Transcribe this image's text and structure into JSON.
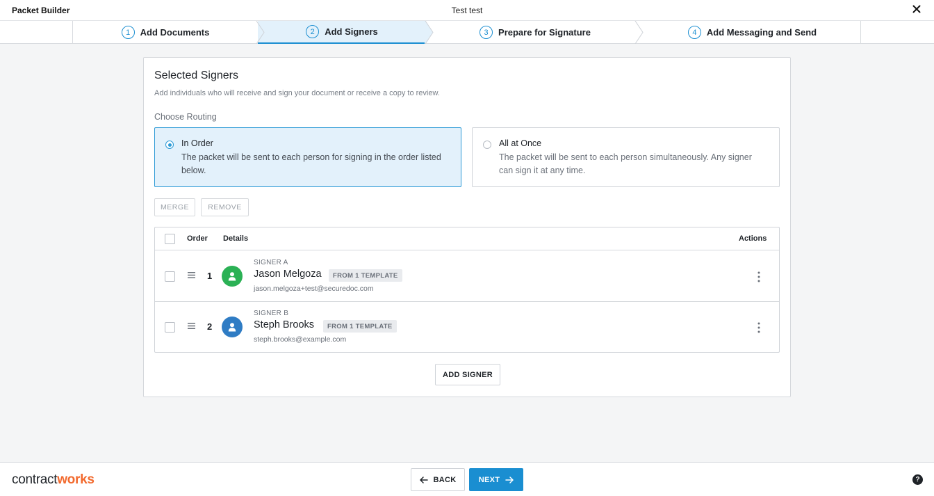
{
  "header": {
    "app_title": "Packet Builder",
    "doc_title": "Test test",
    "close_icon": "close-icon"
  },
  "stepper": {
    "steps": [
      {
        "num": "1",
        "label": "Add Documents",
        "active": false
      },
      {
        "num": "2",
        "label": "Add Signers",
        "active": true
      },
      {
        "num": "3",
        "label": "Prepare for Signature",
        "active": false
      },
      {
        "num": "4",
        "label": "Add Messaging and Send",
        "active": false
      }
    ]
  },
  "card": {
    "title": "Selected Signers",
    "subtitle": "Add individuals who will receive and sign your document or receive a copy to review.",
    "routing_label": "Choose Routing",
    "routing": [
      {
        "title": "In Order",
        "desc": "The packet will be sent to each person for signing in the order listed below.",
        "selected": true
      },
      {
        "title": "All at Once",
        "desc": "The packet will be sent to each person simultaneously. Any signer can sign it at any time.",
        "selected": false
      }
    ],
    "merge_label": "MERGE",
    "remove_label": "REMOVE",
    "table": {
      "headers": {
        "order": "Order",
        "details": "Details",
        "actions": "Actions"
      },
      "rows": [
        {
          "order": "1",
          "role": "SIGNER A",
          "name": "Jason Melgoza",
          "badge": "FROM 1 TEMPLATE",
          "email": "jason.melgoza+test@securedoc.com",
          "avatar_color": "#2bb155"
        },
        {
          "order": "2",
          "role": "SIGNER B",
          "name": "Steph Brooks",
          "badge": "FROM 1 TEMPLATE",
          "email": "steph.brooks@example.com",
          "avatar_color": "#2f7cc4"
        }
      ]
    },
    "add_signer_label": "ADD SIGNER"
  },
  "footer": {
    "logo_regular": "contract",
    "logo_accent": "works",
    "back_label": "BACK",
    "next_label": "NEXT",
    "help_icon": "?"
  },
  "colors": {
    "accent": "#1a8ed1",
    "logo_accent": "#f26a2e",
    "active_step_bg": "#e3f1fb"
  }
}
